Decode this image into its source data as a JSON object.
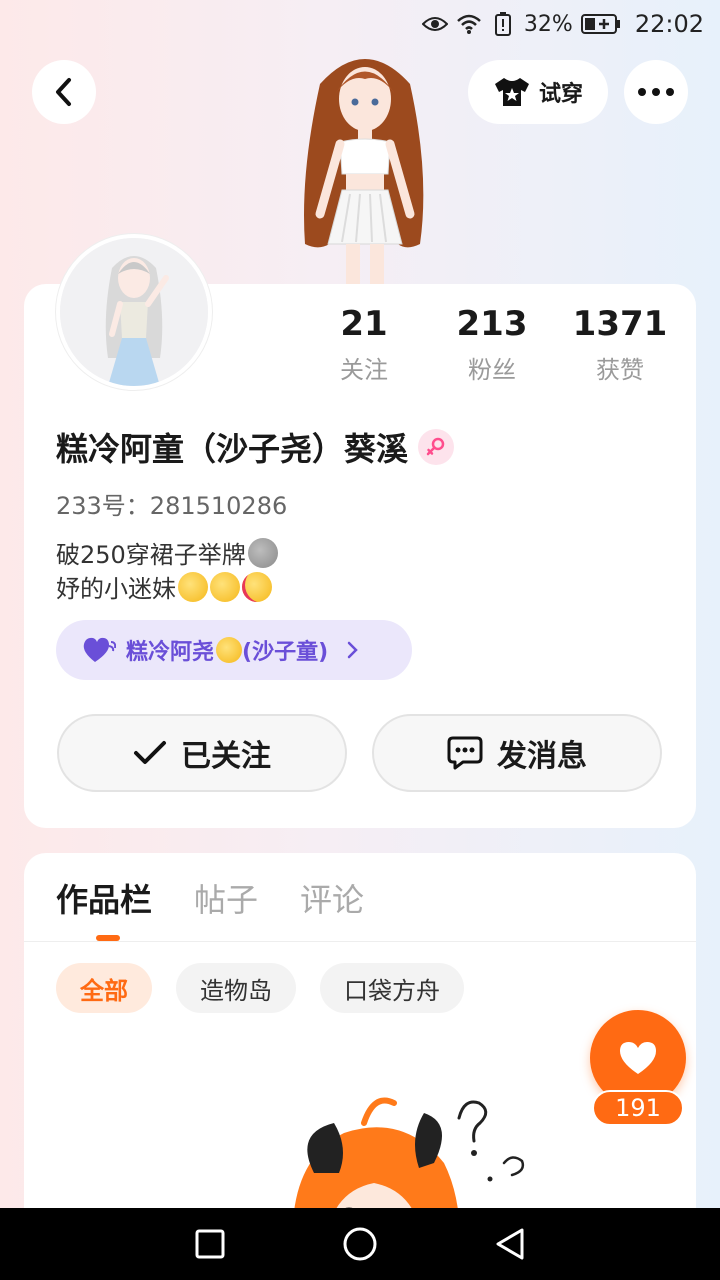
{
  "status_bar": {
    "battery_percent": "32%",
    "time": "22:02",
    "icons": [
      "eye-icon",
      "wifi-icon",
      "battery-alert-icon",
      "battery-icon"
    ]
  },
  "header": {
    "back_icon": "chevron-left-icon",
    "tryon_label": "试穿",
    "tryon_icon": "tshirt-icon",
    "more_icon": "more-dots-icon"
  },
  "profile": {
    "stats": [
      {
        "value": "21",
        "label": "关注"
      },
      {
        "value": "213",
        "label": "粉丝"
      },
      {
        "value": "1371",
        "label": "获赞"
      }
    ],
    "username": "糕冷阿童（沙子尧）葵溪",
    "gender_icon": "female-icon",
    "uid": "233号：281510286",
    "bio_line1": "破250穿裙子举牌",
    "bio_line2": "妤的小迷妹",
    "fan_badge": "糕冷阿尧",
    "fan_badge_suffix": "(沙子童)",
    "followed_label": "已关注",
    "message_label": "发消息"
  },
  "works": {
    "tabs": [
      "作品栏",
      "帖子",
      "评论"
    ],
    "active_tab": "作品栏",
    "chips": [
      "全部",
      "造物岛",
      "口袋方舟"
    ],
    "active_chip": "全部"
  },
  "like": {
    "count": "191"
  },
  "colors": {
    "accent": "#ff6a13",
    "badge_purple": "#6a4fd8",
    "badge_bg": "#ebe7fb"
  }
}
